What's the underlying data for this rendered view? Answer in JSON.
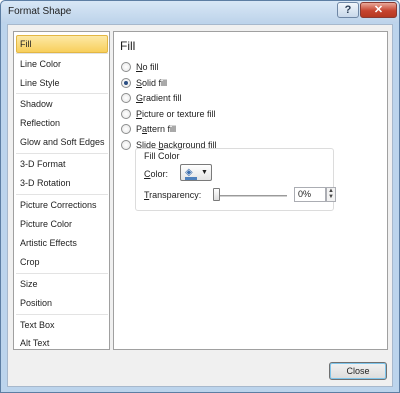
{
  "window": {
    "title": "Format Shape",
    "help_label": "?",
    "close_label": "✕"
  },
  "sidebar": {
    "items": [
      {
        "label": "Fill",
        "selected": true
      },
      {
        "label": "Line Color"
      },
      {
        "label": "Line Style"
      },
      {
        "label": "Shadow"
      },
      {
        "label": "Reflection"
      },
      {
        "label": "Glow and Soft Edges"
      },
      {
        "label": "3-D Format"
      },
      {
        "label": "3-D Rotation"
      },
      {
        "label": "Picture Corrections"
      },
      {
        "label": "Picture Color"
      },
      {
        "label": "Artistic Effects"
      },
      {
        "label": "Crop"
      },
      {
        "label": "Size"
      },
      {
        "label": "Position"
      },
      {
        "label": "Text Box"
      },
      {
        "label": "Alt Text"
      }
    ]
  },
  "panel": {
    "heading": "Fill",
    "options": [
      {
        "pre": "",
        "key": "N",
        "post": "o fill",
        "checked": false
      },
      {
        "pre": "",
        "key": "S",
        "post": "olid fill",
        "checked": true
      },
      {
        "pre": "",
        "key": "G",
        "post": "radient fill",
        "checked": false
      },
      {
        "pre": "",
        "key": "P",
        "post": "icture or texture fill",
        "checked": false
      },
      {
        "pre": "P",
        "key": "a",
        "post": "ttern fill",
        "checked": false
      },
      {
        "pre": "Slide ",
        "key": "b",
        "post": "ackground fill",
        "checked": false
      }
    ],
    "fill_color": {
      "group_title": "Fill Color",
      "color_label_pre": "",
      "color_label_key": "C",
      "color_label_post": "olor:",
      "transparency_label_pre": "",
      "transparency_label_key": "T",
      "transparency_label_post": "ransparency:",
      "transparency_value": "0%",
      "swatch_color": "#4f81bd"
    }
  },
  "footer": {
    "close_label": "Close"
  }
}
